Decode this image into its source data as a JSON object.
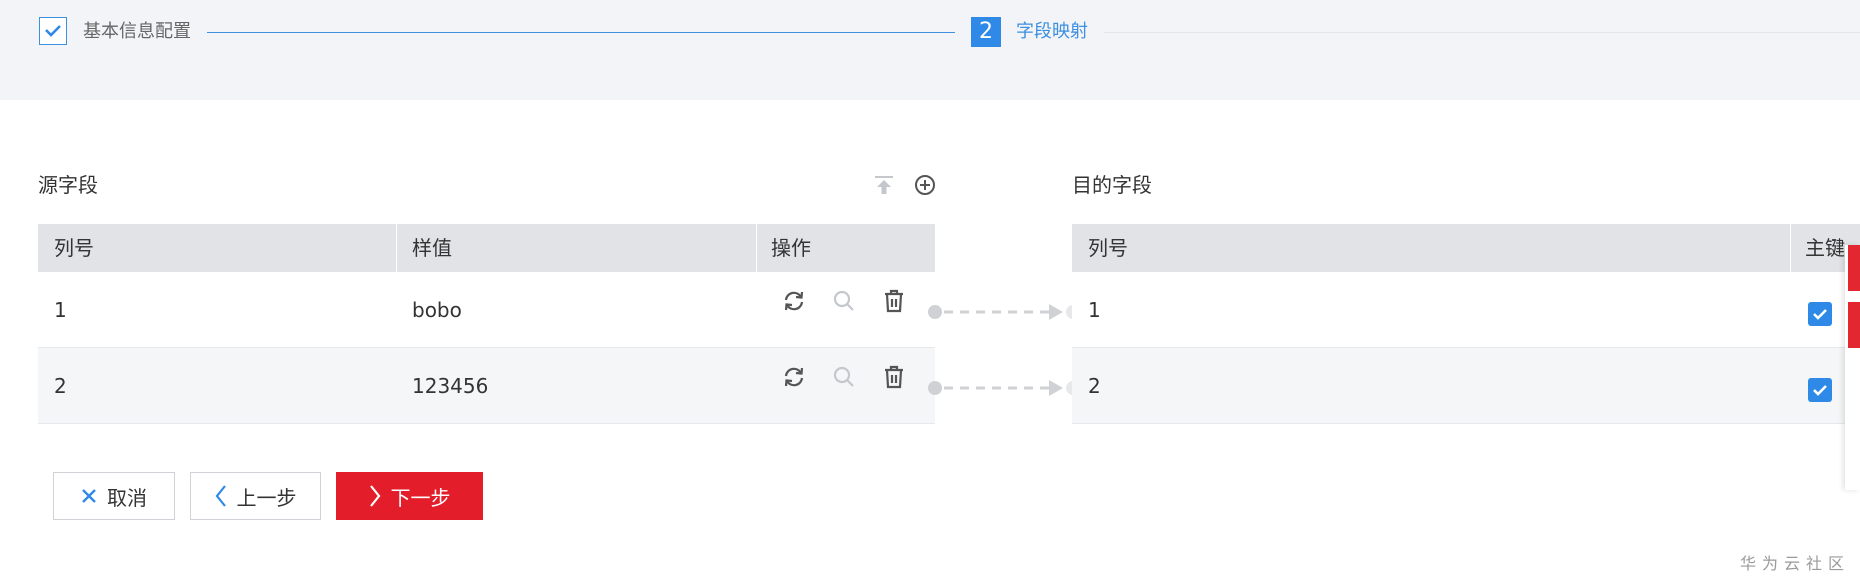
{
  "steps": [
    {
      "label": "基本信息配置",
      "state": "done"
    },
    {
      "number": "2",
      "label": "字段映射",
      "state": "active"
    }
  ],
  "source": {
    "title": "源字段",
    "toolbar_icons": [
      "upload-top-icon",
      "add-circle-icon"
    ],
    "columns": [
      "列号",
      "样值",
      "操作"
    ],
    "rows": [
      {
        "col": "1",
        "sample": "bobo"
      },
      {
        "col": "2",
        "sample": "123456"
      }
    ],
    "row_action_icons": [
      "refresh-icon",
      "search-icon",
      "delete-icon"
    ]
  },
  "target": {
    "title": "目的字段",
    "columns": [
      "列号",
      "主键"
    ],
    "rows": [
      {
        "col": "1",
        "primary_key": true
      },
      {
        "col": "2",
        "primary_key": true
      }
    ]
  },
  "buttons": {
    "cancel": "取消",
    "prev": "上一步",
    "next": "下一步"
  },
  "watermark": "华为云社区",
  "colors": {
    "accent_blue": "#2e8ae6",
    "primary_red": "#e31e2a",
    "header_bg": "#e1e3e6",
    "stepbar_bg": "#f3f4f7"
  }
}
